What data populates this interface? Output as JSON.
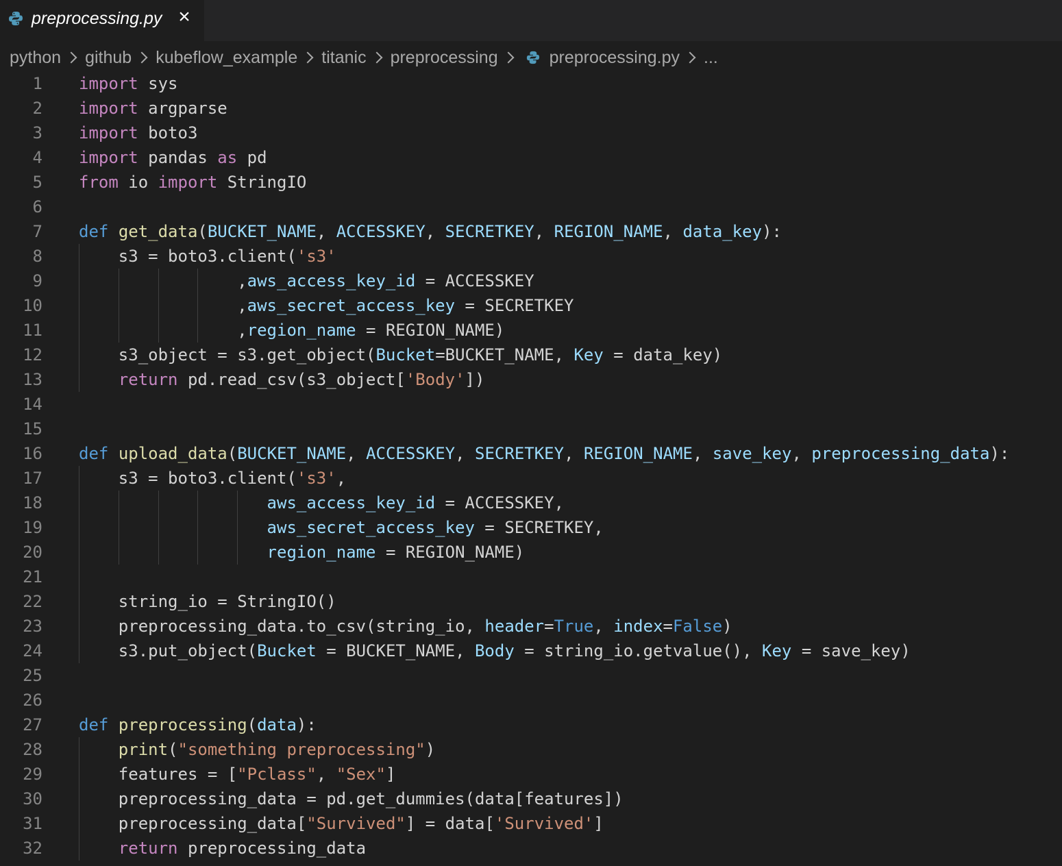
{
  "tab": {
    "filename": "preprocessing.py",
    "icon": "python-file-icon",
    "close_icon": "close-icon"
  },
  "breadcrumb": {
    "items": [
      "python",
      "github",
      "kubeflow_example",
      "titanic",
      "preprocessing",
      "preprocessing.py",
      "..."
    ]
  },
  "colors": {
    "background": "#1e1e1e",
    "keyword": "#c586c0",
    "def": "#569cd6",
    "function": "#dcdcaa",
    "variable": "#9cdcfe",
    "string": "#ce9178",
    "text": "#d4d4d4",
    "line_number": "#858585"
  },
  "editor": {
    "lines": [
      [
        [
          "k",
          "import"
        ],
        [
          "t",
          " sys"
        ]
      ],
      [
        [
          "k",
          "import"
        ],
        [
          "t",
          " argparse"
        ]
      ],
      [
        [
          "k",
          "import"
        ],
        [
          "t",
          " boto3"
        ]
      ],
      [
        [
          "k",
          "import"
        ],
        [
          "t",
          " pandas "
        ],
        [
          "k",
          "as"
        ],
        [
          "t",
          " pd"
        ]
      ],
      [
        [
          "k",
          "from"
        ],
        [
          "t",
          " io "
        ],
        [
          "k",
          "import"
        ],
        [
          "t",
          " StringIO"
        ]
      ],
      [],
      [
        [
          "d",
          "def"
        ],
        [
          "t",
          " "
        ],
        [
          "f",
          "get_data"
        ],
        [
          "t",
          "("
        ],
        [
          "v",
          "BUCKET_NAME"
        ],
        [
          "t",
          ", "
        ],
        [
          "v",
          "ACCESSKEY"
        ],
        [
          "t",
          ", "
        ],
        [
          "v",
          "SECRETKEY"
        ],
        [
          "t",
          ", "
        ],
        [
          "v",
          "REGION_NAME"
        ],
        [
          "t",
          ", "
        ],
        [
          "v",
          "data_key"
        ],
        [
          "t",
          "):"
        ]
      ],
      [
        [
          "t",
          "    s3 = boto3.client("
        ],
        [
          "s",
          "'s3'"
        ]
      ],
      [
        [
          "t",
          "                ,"
        ],
        [
          "v",
          "aws_access_key_id"
        ],
        [
          "t",
          " = ACCESSKEY"
        ]
      ],
      [
        [
          "t",
          "                ,"
        ],
        [
          "v",
          "aws_secret_access_key"
        ],
        [
          "t",
          " = SECRETKEY"
        ]
      ],
      [
        [
          "t",
          "                ,"
        ],
        [
          "v",
          "region_name"
        ],
        [
          "t",
          " = REGION_NAME)"
        ]
      ],
      [
        [
          "t",
          "    s3_object = s3.get_object("
        ],
        [
          "v",
          "Bucket"
        ],
        [
          "t",
          "=BUCKET_NAME, "
        ],
        [
          "v",
          "Key"
        ],
        [
          "t",
          " = data_key)"
        ]
      ],
      [
        [
          "t",
          "    "
        ],
        [
          "k",
          "return"
        ],
        [
          "t",
          " pd.read_csv(s3_object["
        ],
        [
          "s",
          "'Body'"
        ],
        [
          "t",
          "])"
        ]
      ],
      [],
      [],
      [
        [
          "d",
          "def"
        ],
        [
          "t",
          " "
        ],
        [
          "f",
          "upload_data"
        ],
        [
          "t",
          "("
        ],
        [
          "v",
          "BUCKET_NAME"
        ],
        [
          "t",
          ", "
        ],
        [
          "v",
          "ACCESSKEY"
        ],
        [
          "t",
          ", "
        ],
        [
          "v",
          "SECRETKEY"
        ],
        [
          "t",
          ", "
        ],
        [
          "v",
          "REGION_NAME"
        ],
        [
          "t",
          ", "
        ],
        [
          "v",
          "save_key"
        ],
        [
          "t",
          ", "
        ],
        [
          "v",
          "preprocessing_data"
        ],
        [
          "t",
          "):"
        ]
      ],
      [
        [
          "t",
          "    s3 = boto3.client("
        ],
        [
          "s",
          "'s3'"
        ],
        [
          "t",
          ","
        ]
      ],
      [
        [
          "t",
          "                   "
        ],
        [
          "v",
          "aws_access_key_id"
        ],
        [
          "t",
          " = ACCESSKEY,"
        ]
      ],
      [
        [
          "t",
          "                   "
        ],
        [
          "v",
          "aws_secret_access_key"
        ],
        [
          "t",
          " = SECRETKEY,"
        ]
      ],
      [
        [
          "t",
          "                   "
        ],
        [
          "v",
          "region_name"
        ],
        [
          "t",
          " = REGION_NAME)"
        ]
      ],
      [],
      [
        [
          "t",
          "    string_io = StringIO()"
        ]
      ],
      [
        [
          "t",
          "    preprocessing_data.to_csv(string_io, "
        ],
        [
          "v",
          "header"
        ],
        [
          "t",
          "="
        ],
        [
          "d",
          "True"
        ],
        [
          "t",
          ", "
        ],
        [
          "v",
          "index"
        ],
        [
          "t",
          "="
        ],
        [
          "d",
          "False"
        ],
        [
          "t",
          ")"
        ]
      ],
      [
        [
          "t",
          "    s3.put_object("
        ],
        [
          "v",
          "Bucket"
        ],
        [
          "t",
          " = BUCKET_NAME, "
        ],
        [
          "v",
          "Body"
        ],
        [
          "t",
          " = string_io.getvalue(), "
        ],
        [
          "v",
          "Key"
        ],
        [
          "t",
          " = save_key)"
        ]
      ],
      [],
      [],
      [
        [
          "d",
          "def"
        ],
        [
          "t",
          " "
        ],
        [
          "f",
          "preprocessing"
        ],
        [
          "t",
          "("
        ],
        [
          "v",
          "data"
        ],
        [
          "t",
          "):"
        ]
      ],
      [
        [
          "t",
          "    "
        ],
        [
          "f",
          "print"
        ],
        [
          "t",
          "("
        ],
        [
          "s",
          "\"something preprocessing\""
        ],
        [
          "t",
          ")"
        ]
      ],
      [
        [
          "t",
          "    features = ["
        ],
        [
          "s",
          "\"Pclass\""
        ],
        [
          "t",
          ", "
        ],
        [
          "s",
          "\"Sex\""
        ],
        [
          "t",
          "]"
        ]
      ],
      [
        [
          "t",
          "    preprocessing_data = pd.get_dummies(data[features])"
        ]
      ],
      [
        [
          "t",
          "    preprocessing_data["
        ],
        [
          "s",
          "\"Survived\""
        ],
        [
          "t",
          "] = data["
        ],
        [
          "s",
          "'Survived'"
        ],
        [
          "t",
          "]"
        ]
      ],
      [
        [
          "t",
          "    "
        ],
        [
          "k",
          "return"
        ],
        [
          "t",
          " preprocessing_data"
        ]
      ]
    ]
  }
}
